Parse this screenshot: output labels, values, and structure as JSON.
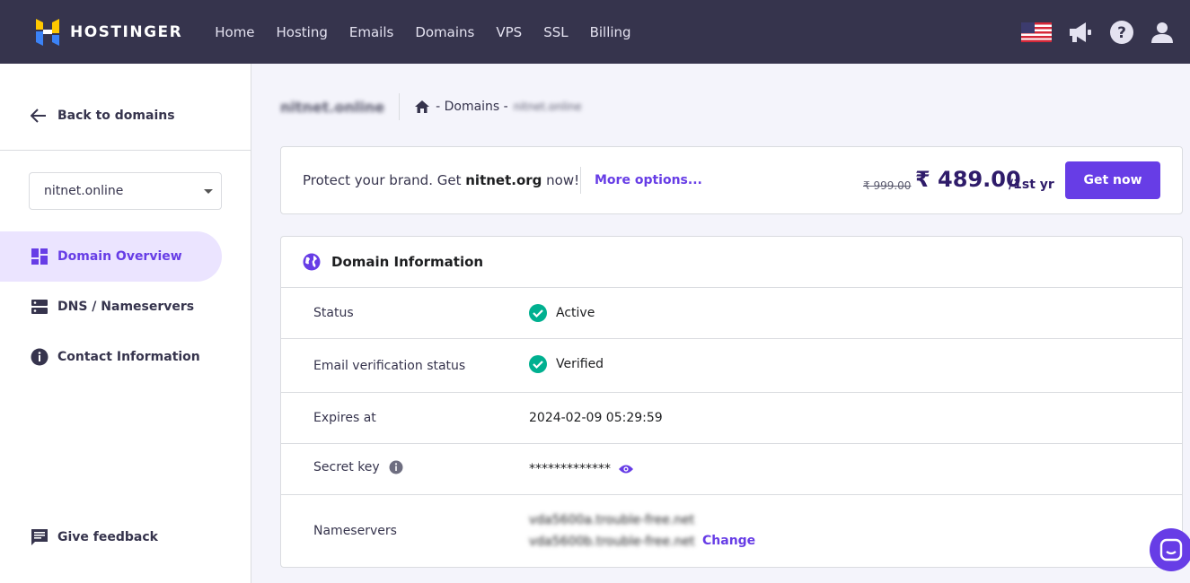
{
  "header": {
    "brand": "HOSTINGER",
    "nav": [
      "Home",
      "Hosting",
      "Emails",
      "Domains",
      "VPS",
      "SSL",
      "Billing"
    ]
  },
  "sidebar": {
    "back_label": "Back to domains",
    "selected_domain": "nitnet.online",
    "items": [
      {
        "label": "Domain Overview",
        "icon": "dashboard-icon",
        "active": true
      },
      {
        "label": "DNS / Nameservers",
        "icon": "server-icon",
        "active": false
      },
      {
        "label": "Contact Information",
        "icon": "info-icon",
        "active": false
      }
    ],
    "feedback_label": "Give feedback"
  },
  "breadcrumb": {
    "title": "nitnet.online",
    "path_label": "- Domains -",
    "current": "nitnet.online"
  },
  "promo": {
    "text_before": "Protect your brand. Get ",
    "domain": "nitnet.org",
    "text_after": " now!",
    "more_options": "More options...",
    "old_price": "₹ 999.00",
    "price": "₹ 489.00",
    "period": "/1st yr",
    "button": "Get now"
  },
  "domain_info": {
    "title": "Domain Information",
    "status_label": "Status",
    "status_value": "Active",
    "email_verif_label": "Email verification status",
    "email_verif_value": "Verified",
    "expires_label": "Expires at",
    "expires_value": "2024-02-09 05:29:59",
    "secret_label": "Secret key",
    "secret_value": "*************",
    "nameservers_label": "Nameservers",
    "nameservers": [
      "vda5600a.trouble-free.net",
      "vda5600b.trouble-free.net"
    ],
    "change_label": "Change"
  },
  "colors": {
    "accent": "#673de6",
    "topbar": "#36344d",
    "success": "#00b090"
  }
}
